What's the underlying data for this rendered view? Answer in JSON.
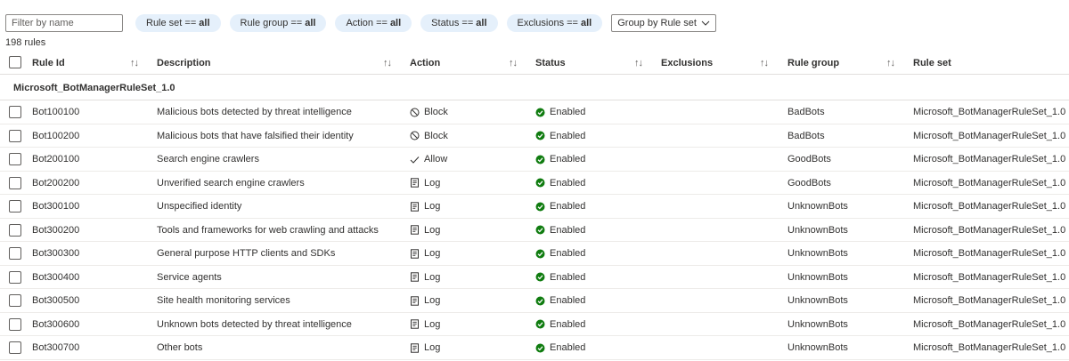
{
  "filter": {
    "placeholder": "Filter by name",
    "value": ""
  },
  "pills": [
    {
      "label": "Rule set ==",
      "value": "all"
    },
    {
      "label": "Rule group ==",
      "value": "all"
    },
    {
      "label": "Action ==",
      "value": "all"
    },
    {
      "label": "Status ==",
      "value": "all"
    },
    {
      "label": "Exclusions ==",
      "value": "all"
    }
  ],
  "group_by": {
    "label": "Group by Rule set"
  },
  "count": "198 rules",
  "columns": {
    "rule_id": "Rule Id",
    "description": "Description",
    "action": "Action",
    "status": "Status",
    "exclusions": "Exclusions",
    "rule_group": "Rule group",
    "rule_set": "Rule set"
  },
  "sort_glyph": "↑↓",
  "group": "Microsoft_BotManagerRuleSet_1.0",
  "colors": {
    "pill_bg": "#e5f0fb",
    "enabled_green": "#107c10",
    "border": "#e1dfdd"
  },
  "rows": [
    {
      "id": "Bot100100",
      "description": "Malicious bots detected by threat intelligence",
      "action": "Block",
      "action_icon": "block-icon",
      "status": "Enabled",
      "exclusions": "",
      "rule_group": "BadBots",
      "rule_set": "Microsoft_BotManagerRuleSet_1.0"
    },
    {
      "id": "Bot100200",
      "description": "Malicious bots that have falsified their identity",
      "action": "Block",
      "action_icon": "block-icon",
      "status": "Enabled",
      "exclusions": "",
      "rule_group": "BadBots",
      "rule_set": "Microsoft_BotManagerRuleSet_1.0"
    },
    {
      "id": "Bot200100",
      "description": "Search engine crawlers",
      "action": "Allow",
      "action_icon": "checkmark-icon",
      "status": "Enabled",
      "exclusions": "",
      "rule_group": "GoodBots",
      "rule_set": "Microsoft_BotManagerRuleSet_1.0"
    },
    {
      "id": "Bot200200",
      "description": "Unverified search engine crawlers",
      "action": "Log",
      "action_icon": "log-icon",
      "status": "Enabled",
      "exclusions": "",
      "rule_group": "GoodBots",
      "rule_set": "Microsoft_BotManagerRuleSet_1.0"
    },
    {
      "id": "Bot300100",
      "description": "Unspecified identity",
      "action": "Log",
      "action_icon": "log-icon",
      "status": "Enabled",
      "exclusions": "",
      "rule_group": "UnknownBots",
      "rule_set": "Microsoft_BotManagerRuleSet_1.0"
    },
    {
      "id": "Bot300200",
      "description": "Tools and frameworks for web crawling and attacks",
      "action": "Log",
      "action_icon": "log-icon",
      "status": "Enabled",
      "exclusions": "",
      "rule_group": "UnknownBots",
      "rule_set": "Microsoft_BotManagerRuleSet_1.0"
    },
    {
      "id": "Bot300300",
      "description": "General purpose HTTP clients and SDKs",
      "action": "Log",
      "action_icon": "log-icon",
      "status": "Enabled",
      "exclusions": "",
      "rule_group": "UnknownBots",
      "rule_set": "Microsoft_BotManagerRuleSet_1.0"
    },
    {
      "id": "Bot300400",
      "description": "Service agents",
      "action": "Log",
      "action_icon": "log-icon",
      "status": "Enabled",
      "exclusions": "",
      "rule_group": "UnknownBots",
      "rule_set": "Microsoft_BotManagerRuleSet_1.0"
    },
    {
      "id": "Bot300500",
      "description": "Site health monitoring services",
      "action": "Log",
      "action_icon": "log-icon",
      "status": "Enabled",
      "exclusions": "",
      "rule_group": "UnknownBots",
      "rule_set": "Microsoft_BotManagerRuleSet_1.0"
    },
    {
      "id": "Bot300600",
      "description": "Unknown bots detected by threat intelligence",
      "action": "Log",
      "action_icon": "log-icon",
      "status": "Enabled",
      "exclusions": "",
      "rule_group": "UnknownBots",
      "rule_set": "Microsoft_BotManagerRuleSet_1.0"
    },
    {
      "id": "Bot300700",
      "description": "Other bots",
      "action": "Log",
      "action_icon": "log-icon",
      "status": "Enabled",
      "exclusions": "",
      "rule_group": "UnknownBots",
      "rule_set": "Microsoft_BotManagerRuleSet_1.0"
    }
  ]
}
